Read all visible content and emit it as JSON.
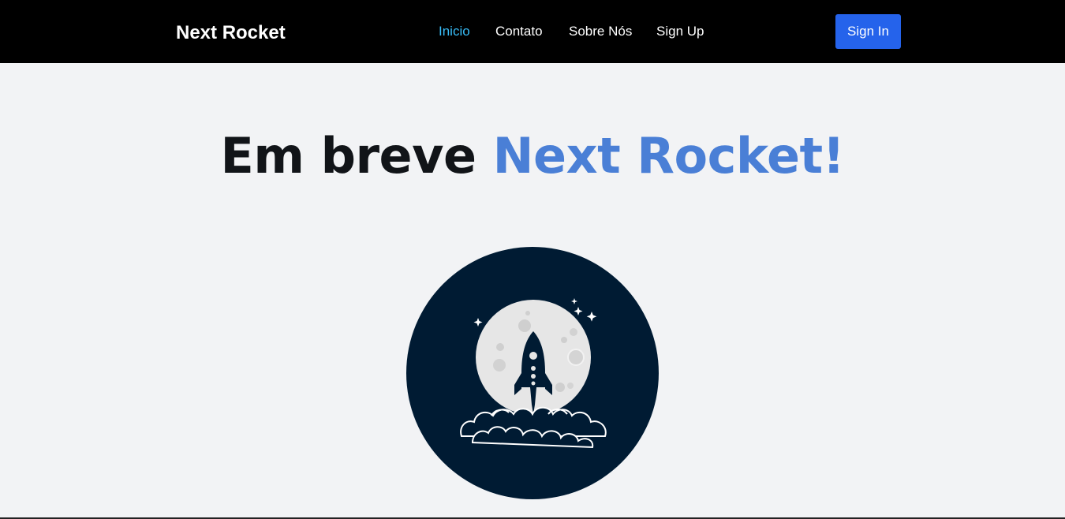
{
  "navbar": {
    "brand": "Next Rocket",
    "links": [
      {
        "label": "Inicio",
        "active": true
      },
      {
        "label": "Contato",
        "active": false
      },
      {
        "label": "Sobre Nós",
        "active": false
      },
      {
        "label": "Sign Up",
        "active": false
      }
    ],
    "signin_label": "Sign In"
  },
  "hero": {
    "title_prefix": "Em breve",
    "title_accent": "Next Rocket!"
  },
  "illustration": {
    "icon": "rocket-moon-icon"
  },
  "colors": {
    "navbar_bg": "#000000",
    "page_bg": "#f2f3f5",
    "active_link": "#38bdf8",
    "button_bg": "#2563eb",
    "title_accent": "#4a7fd6",
    "badge_bg": "#001b33"
  }
}
